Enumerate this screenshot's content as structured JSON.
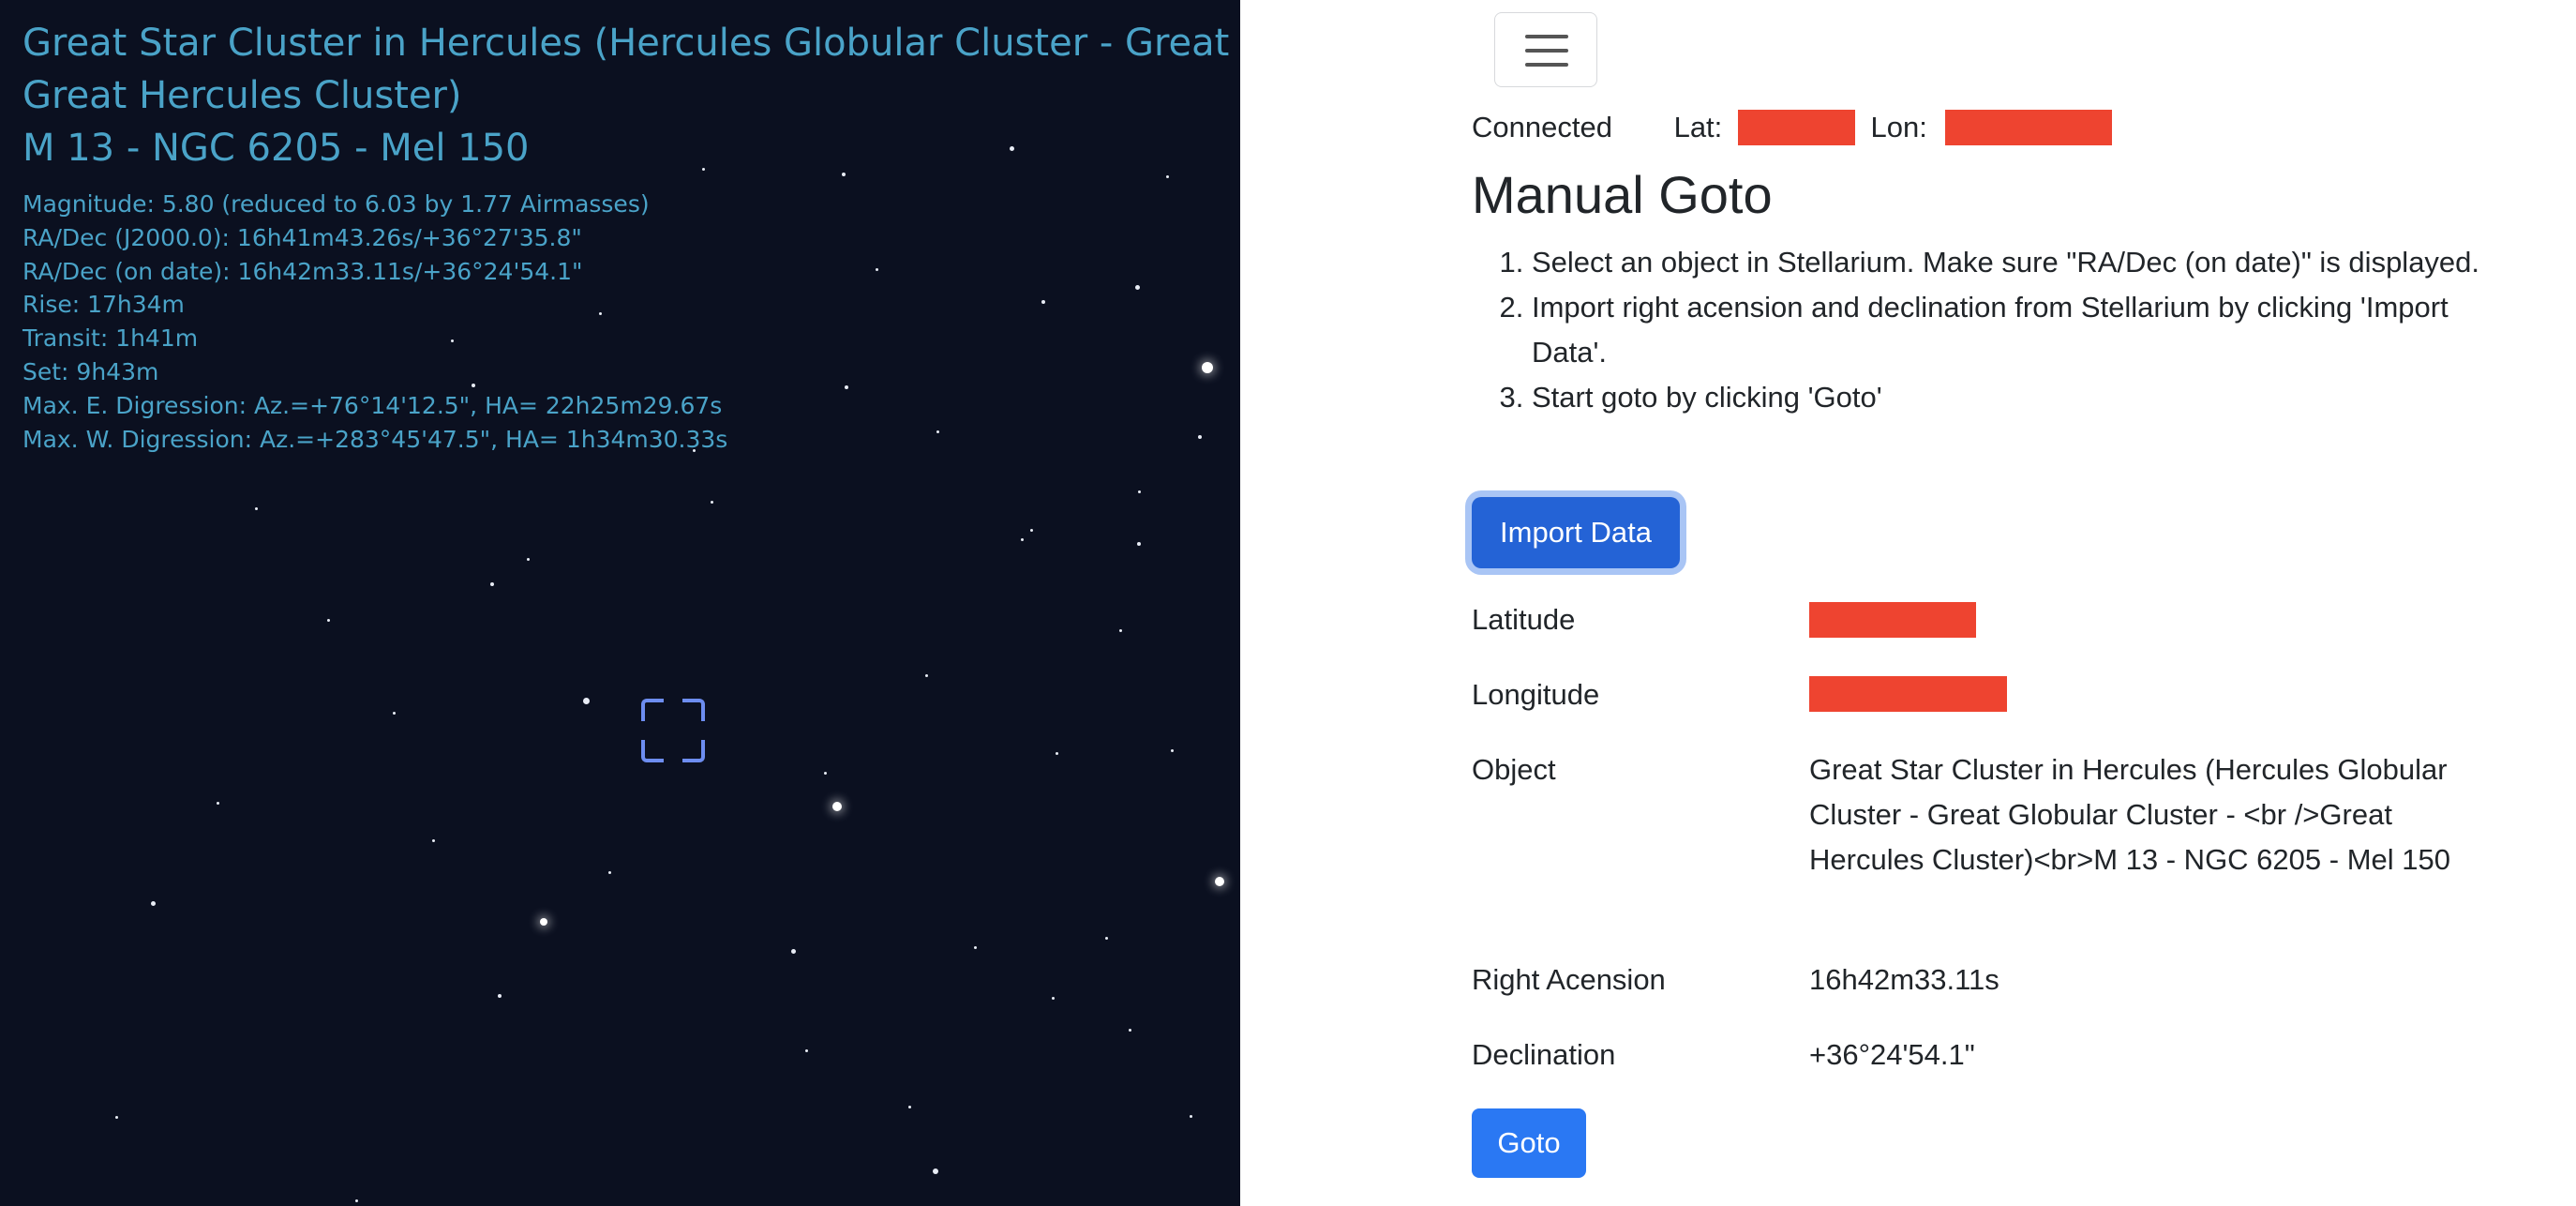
{
  "stellarium": {
    "title_lines": [
      "Great Star Cluster in Hercules (Hercules Globular Cluster - Great Globular Cluster -",
      "Great Hercules Cluster)",
      "M 13 - NGC 6205 - Mel 150"
    ],
    "info_lines": [
      "Magnitude: 5.80 (reduced to 6.03 by 1.77 Airmasses)",
      "RA/Dec (J2000.0): 16h41m43.26s/+36°27'35.8\"",
      "RA/Dec (on date): 16h42m33.11s/+36°24'54.1\"",
      "Rise: 17h34m",
      "Transit: 1h41m",
      "Set: 9h43m",
      "Max. E. Digression: Az.=+76°14'12.5\", HA= 22h25m29.67s",
      "Max. W. Digression: Az.=+283°45'47.5\", HA= 1h34m30.33s"
    ],
    "colors": {
      "sky": "#0b1020",
      "info_text": "#4aa3c8",
      "reticle": "#6d8df0"
    }
  },
  "web": {
    "menu_icon": "hamburger-icon",
    "status": {
      "connection": "Connected",
      "lat_label": "Lat:",
      "lon_label": "Lon:"
    },
    "title": "Manual Goto",
    "steps": [
      "Select an object in Stellarium. Make sure \"RA/Dec (on date)\" is displayed.",
      "Import right acension and declination from Stellarium by clicking 'Import Data'.",
      "Start goto by clicking 'Goto'"
    ],
    "import_label": "Import Data",
    "fields": {
      "latitude_label": "Latitude",
      "longitude_label": "Longitude",
      "object_label": "Object",
      "object_value": "Great Star Cluster in Hercules (Hercules Globular Cluster - Great Globular Cluster - <br />Great Hercules Cluster)<br>M 13 - NGC 6205 - Mel 150",
      "ra_label": "Right Acension",
      "ra_value": "16h42m33.11s",
      "dec_label": "Declination",
      "dec_value": "+36°24'54.1\""
    },
    "goto_label": "Goto",
    "colors": {
      "primary": "#2463d6",
      "redaction": "#ee4430"
    }
  }
}
